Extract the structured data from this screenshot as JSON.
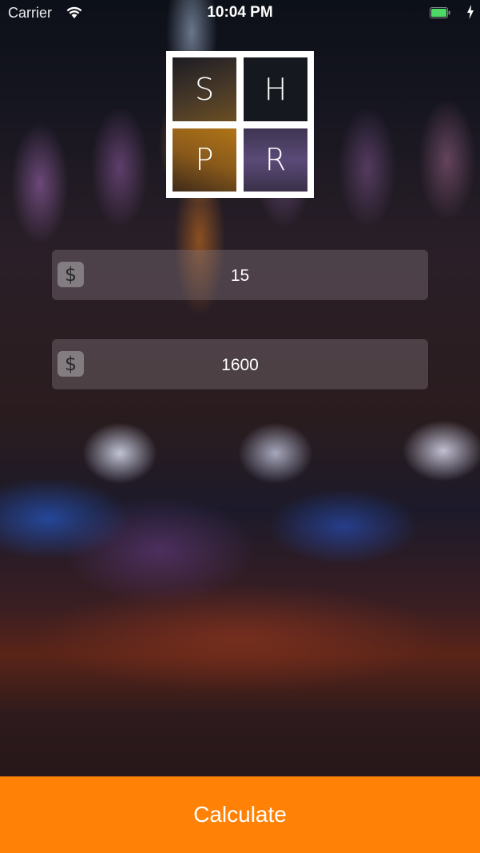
{
  "status_bar": {
    "carrier": "Carrier",
    "time": "10:04 PM",
    "wifi_icon": "wifi-icon",
    "battery_icon": "battery-icon",
    "battery_color": "#4cd964",
    "charge_icon": "charging-bolt-icon"
  },
  "logo": {
    "letters": [
      "S",
      "H",
      "P",
      "R"
    ]
  },
  "fields": [
    {
      "icon": "dollar-sign-icon",
      "icon_glyph": "$",
      "value": "15"
    },
    {
      "icon": "dollar-sign-icon",
      "icon_glyph": "$",
      "value": "1600"
    }
  ],
  "calculate_button": {
    "label": "Calculate",
    "color": "#ff8207"
  }
}
